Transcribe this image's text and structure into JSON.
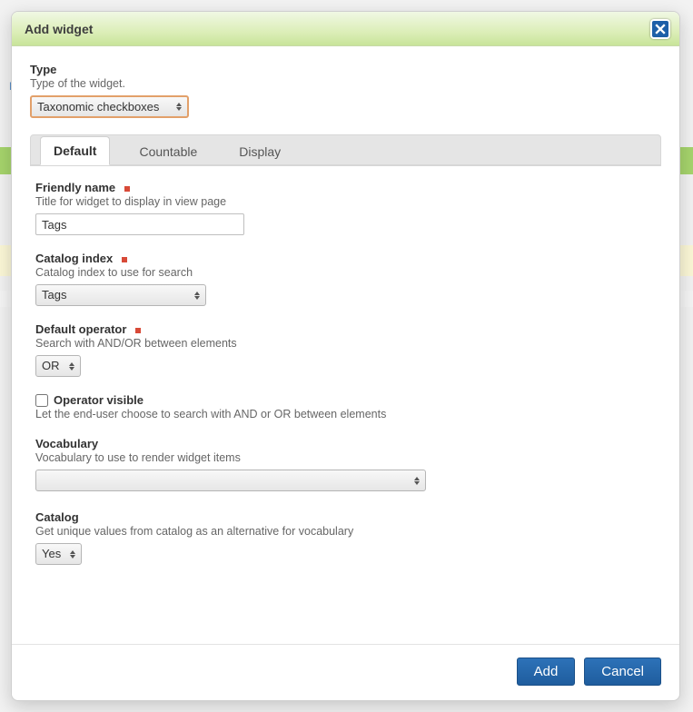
{
  "background": {
    "letter_p": "P"
  },
  "dialog": {
    "title": "Add widget"
  },
  "form": {
    "type": {
      "label": "Type",
      "help": "Type of the widget.",
      "value": "Taxonomic checkboxes"
    },
    "friendly_name": {
      "label": "Friendly name",
      "help": "Title for widget to display in view page",
      "value": "Tags"
    },
    "catalog_index": {
      "label": "Catalog index",
      "help": "Catalog index to use for search",
      "value": "Tags"
    },
    "default_operator": {
      "label": "Default operator",
      "help": "Search with AND/OR between elements",
      "value": "OR"
    },
    "operator_visible": {
      "label": "Operator visible",
      "help": "Let the end-user choose to search with AND or OR between elements",
      "checked": false
    },
    "vocabulary": {
      "label": "Vocabulary",
      "help": "Vocabulary to use to render widget items",
      "value": ""
    },
    "catalog": {
      "label": "Catalog",
      "help": "Get unique values from catalog as an alternative for vocabulary",
      "value": "Yes"
    }
  },
  "tabs": [
    "Default",
    "Countable",
    "Display"
  ],
  "footer": {
    "add": "Add",
    "cancel": "Cancel"
  }
}
